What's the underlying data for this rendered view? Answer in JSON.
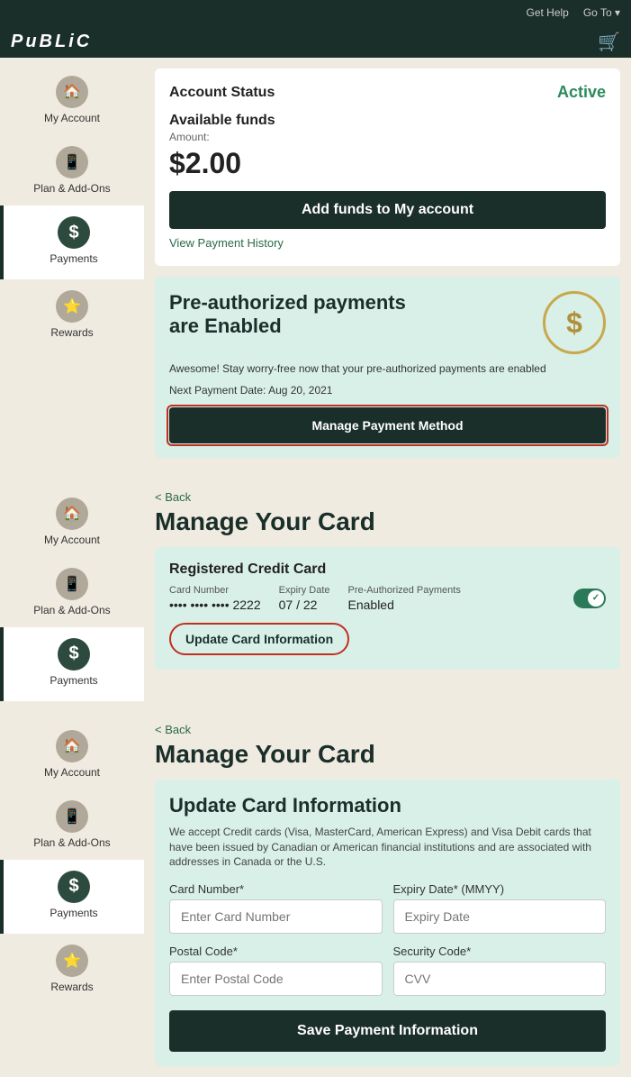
{
  "brand": {
    "logo": "PuBLiC",
    "cart_icon": "🛒"
  },
  "nav": {
    "items": [
      "Get Help",
      "Go To",
      "Cart"
    ]
  },
  "section1": {
    "sidebar": [
      {
        "label": "My Account",
        "icon": "🏠",
        "active": false
      },
      {
        "label": "Plan & Add-Ons",
        "icon": "📱",
        "active": false
      },
      {
        "label": "Payments",
        "icon": "$",
        "active": true
      },
      {
        "label": "Rewards",
        "icon": "⭐",
        "active": false
      }
    ],
    "account_status": {
      "title": "Account Status",
      "status": "Active",
      "available_funds_label": "Available funds",
      "amount_label": "Amount:",
      "amount": "$2.00",
      "add_funds_button": "Add funds to My account",
      "view_history_link": "View Payment History"
    },
    "preauth": {
      "title": "Pre-authorized payments are Enabled",
      "description": "Awesome! Stay worry-free now that your pre-authorized payments are enabled",
      "next_payment_label": "Next Payment Date:",
      "next_payment_date": "Aug 20, 2021",
      "manage_button": "Manage Payment Method",
      "dollar_icon": "$"
    }
  },
  "section2": {
    "sidebar": [
      {
        "label": "My Account",
        "icon": "🏠",
        "active": false
      },
      {
        "label": "Plan & Add-Ons",
        "icon": "📱",
        "active": false
      },
      {
        "label": "Payments",
        "icon": "$",
        "active": true
      }
    ],
    "back_link": "Back",
    "title": "Manage Your Card",
    "registered_card": {
      "title": "Registered Credit Card",
      "card_number_label": "Card Number",
      "card_number_value": "•••• •••• •••• 2222",
      "expiry_label": "Expiry Date",
      "expiry_value": "07 / 22",
      "preauth_label": "Pre-Authorized Payments",
      "preauth_value": "Enabled",
      "toggle_check": "✓",
      "update_button": "Update Card Information"
    }
  },
  "section3": {
    "sidebar": [
      {
        "label": "My Account",
        "icon": "🏠",
        "active": false
      },
      {
        "label": "Plan & Add-Ons",
        "icon": "📱",
        "active": false
      },
      {
        "label": "Payments",
        "icon": "$",
        "active": true
      },
      {
        "label": "Rewards",
        "icon": "⭐",
        "active": false
      }
    ],
    "back_link": "Back",
    "title": "Manage Your Card",
    "form": {
      "title": "Update Card Information",
      "description": "We accept Credit cards (Visa, MasterCard, American Express) and Visa Debit cards that have been issued by Canadian or American financial institutions and are associated with addresses in Canada or the U.S.",
      "card_number_label": "Card Number*",
      "card_number_placeholder": "Enter Card Number",
      "expiry_label": "Expiry Date* (MMYY)",
      "expiry_placeholder": "Expiry Date",
      "postal_label": "Postal Code*",
      "postal_placeholder": "Enter Postal Code",
      "security_label": "Security Code*",
      "security_placeholder": "CVV",
      "save_button": "Save Payment Information"
    }
  }
}
